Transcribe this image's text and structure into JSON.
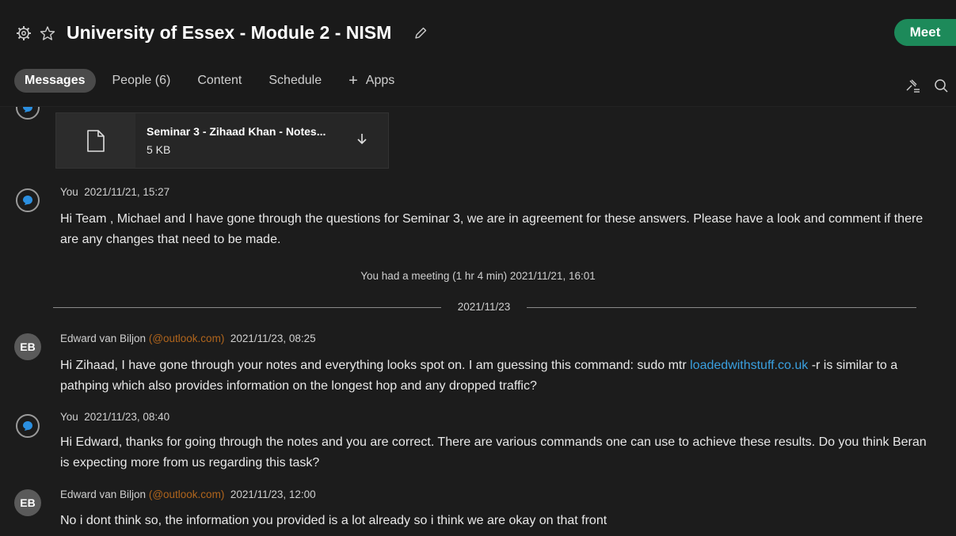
{
  "header": {
    "title": "University of Essex - Module 2 - NISM",
    "meet_label": "Meet",
    "tabs": [
      {
        "label": "Messages"
      },
      {
        "label": "People (6)"
      },
      {
        "label": "Content"
      },
      {
        "label": "Schedule"
      },
      {
        "label": "Apps"
      }
    ],
    "icons": [
      "gear-icon",
      "star-icon",
      "pencil-icon",
      "pin-list-icon",
      "search-icon"
    ],
    "accent_color": "#1d8a5a"
  },
  "file": {
    "name": "Seminar 3 - Zihaad Khan - Notes...",
    "size": "5 KB"
  },
  "messages": [
    {
      "author": "You",
      "time": "2021/11/21, 15:27",
      "text": "Hi Team , Michael and I have gone through the questions for Seminar 3, we are in agreement for these answers. Please have a look and comment if there are any changes that need to be made."
    },
    {
      "author": "Edward van Biljon",
      "initials": "EB",
      "email": "(@outlook.com)",
      "time": "2021/11/23, 08:25",
      "text_before": "Hi Zihaad, I have gone through your notes and everything looks spot on. I am guessing this command: sudo mtr ",
      "link": "loadedwithstuff.co.uk",
      "text_after": " -r is similar to a pathping which also provides information on the longest hop and any dropped traffic?"
    },
    {
      "author": "You",
      "time": "2021/11/23, 08:40",
      "text": "Hi Edward, thanks for going through the notes and you are correct. There are various commands one can use to achieve these results.  Do you think Beran is expecting more from us regarding this task?"
    },
    {
      "author": "Edward van Biljon",
      "initials": "EB",
      "email": "(@outlook.com)",
      "time": "2021/11/23, 12:00",
      "text": "No i dont think so, the information you provided is a lot already so i think we are okay on that front"
    }
  ],
  "system_note": "You had a meeting (1 hr 4 min) 2021/11/21, 16:01",
  "date_separator": "2021/11/23"
}
